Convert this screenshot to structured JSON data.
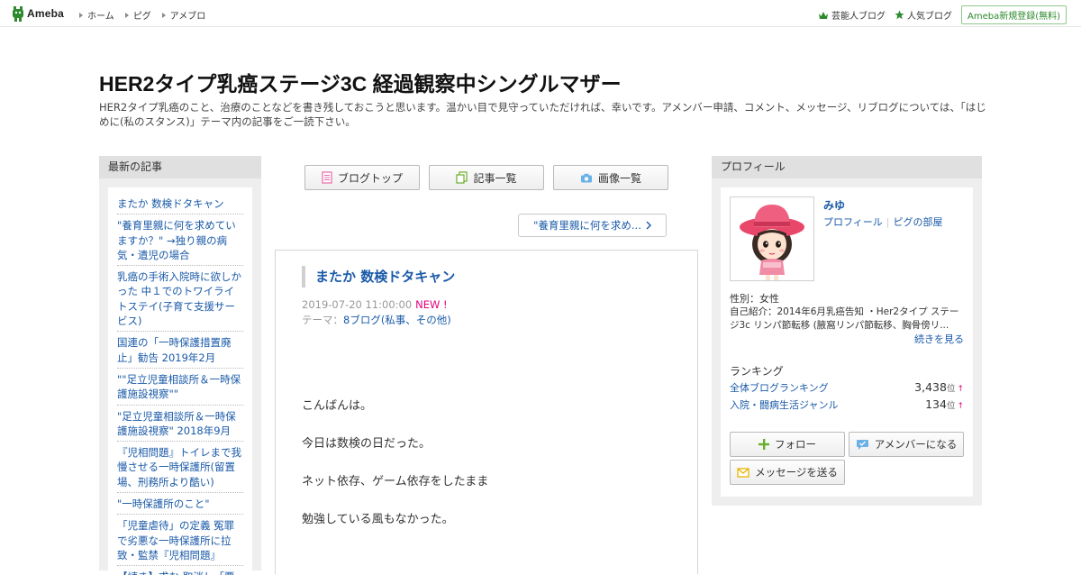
{
  "topbar": {
    "logo_text": "Ameba",
    "nav": [
      "ホーム",
      "ピグ",
      "アメブロ"
    ],
    "celebrity_blog": "芸能人ブログ",
    "popular_blog": "人気ブログ",
    "register": "Ameba新規登録(無料)"
  },
  "header": {
    "title": "HER2タイプ乳癌ステージ3C 経過観察中シングルマザー",
    "description": "HER2タイプ乳癌のこと、治療のことなどを書き残しておこうと思います。温かい目で見守っていただければ、幸いです。アメンバー申請、コメント、メッセージ、リブログについては、「はじめに(私のスタンス)」テーマ内の記事をご一読下さい。"
  },
  "sidebar_left": {
    "heading": "最新の記事",
    "items": [
      "またか 数検ドタキャン",
      "\"養育里親に何を求めていますか？\" →独り親の病気・遺児の場合",
      "乳癌の手術入院時に欲しかった 中１でのトワイライトステイ(子育て支援サービス)",
      "国連の「一時保護措置廃止」勧告 2019年2月",
      "\"\"足立児童相談所＆一時保護施設視察\"\"",
      "\"足立児童相談所＆一時保護施設視察\" 2018年9月",
      "『児相問題』トイレまで我慢させる一時保護所(留置場、刑務所より酷い)",
      "\"一時保護所のこと\"",
      "「児童虐待」の定義 冤罪で劣悪な一時保護所に拉致・監禁『児相問題』",
      "【続き】求む:取消し「要"
    ]
  },
  "center": {
    "buttons": {
      "blog_top": "ブログトップ",
      "article_list": "記事一覧",
      "image_list": "画像一覧"
    },
    "next_link": "\"養育里親に何を求め...",
    "article": {
      "title": "またか 数検ドタキャン",
      "date": "2019-07-20 11:00:00",
      "new_badge": "NEW !",
      "theme_label": "テーマ：",
      "theme": "8ブログ(私事、その他)",
      "paragraphs": [
        "こんばんは。",
        "今日は数検の日だった。",
        "ネット依存、ゲーム依存をしたまま",
        "勉強している風もなかった。"
      ]
    }
  },
  "sidebar_right": {
    "heading": "プロフィール",
    "name": "みゆ",
    "profile_link": "プロフィール",
    "pigg_room": "ピグの部屋",
    "gender": "性別：女性",
    "intro": "自己紹介：2014年6月乳癌告知 ・Her2タイプ ステージ3c リンパ節転移 (腋窩リンパ節転移、胸骨傍リ...",
    "more": "続きを見る",
    "ranking_heading": "ランキング",
    "rankings": [
      {
        "label": "全体ブログランキング",
        "value": "3,438",
        "unit": "位",
        "trend": "↑"
      },
      {
        "label": "入院・闘病生活ジャンル",
        "value": "134",
        "unit": "位",
        "trend": "↑"
      }
    ],
    "follow": "フォロー",
    "amember": "アメンバーになる",
    "message": "メッセージを送る"
  },
  "colors": {
    "link": "#1a5aa8",
    "new_badge": "#e4007f",
    "brand_green": "#2d8a2d"
  }
}
